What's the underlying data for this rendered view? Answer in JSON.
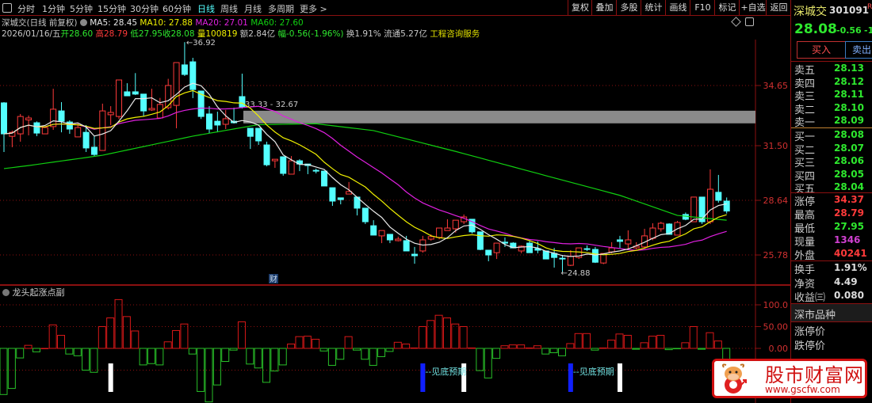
{
  "toolbar": {
    "tabs": [
      "分时",
      "1分钟",
      "5分钟",
      "15分钟",
      "30分钟",
      "60分钟",
      "日线",
      "周线",
      "月线",
      "多周期",
      "更多 >"
    ],
    "active_tab": "日线",
    "buttons": [
      "复权",
      "叠加",
      "多股",
      "统计",
      "画线",
      "F10",
      "标记",
      "+自选",
      "返回"
    ]
  },
  "info": {
    "title": "深城交(日线 前复权)",
    "ma5": "MA5: 28.45",
    "ma10": "MA10: 27.88",
    "ma20": "MA20: 27.01",
    "ma60": "MA60: 27.60",
    "date": "2026/01/16/五",
    "open_label": "开",
    "open": "28.60",
    "high_label": "高",
    "high": "28.79",
    "low_label": "低",
    "low": "27.95",
    "close_label": "收",
    "close": "28.08",
    "vol_label": "量",
    "vol": "100819",
    "amount": "额2.84亿",
    "change_label": "幅",
    "change": "-0.56(-1.96%)",
    "turnover": "换1.91%",
    "float": "流通5.27亿",
    "sector": "工程咨询服务"
  },
  "colors": {
    "up": "#ff3a3a",
    "down": "#54ffff",
    "ma5": "#e8e8e8",
    "ma10": "#f0f000",
    "ma20": "#e020e0",
    "ma60": "#10d010",
    "grid": "#8b1010",
    "axis_text": "#d03030",
    "band": "#8a8a8a"
  },
  "chart_data": [
    {
      "type": "candlestick",
      "price_ticks": [
        "34.65",
        "31.50",
        "28.64",
        "25.78"
      ],
      "ylim": [
        24.5,
        37.0
      ],
      "annotations": {
        "high_label": "36.92",
        "low_label": "24.88",
        "band_label": "33.33 - 32.67",
        "band": [
          32.67,
          33.33
        ],
        "finance_marker": "财"
      },
      "ohlc": [
        [
          33.74,
          33.78,
          31.17,
          32.12
        ],
        [
          31.99,
          32.29,
          31.42,
          32.2
        ],
        [
          32.12,
          33.16,
          31.71,
          33.03
        ],
        [
          32.85,
          33.08,
          32.04,
          32.95
        ],
        [
          32.7,
          32.77,
          32.0,
          32.16
        ],
        [
          32.12,
          32.45,
          32.12,
          32.45
        ],
        [
          32.5,
          34.48,
          32.33,
          33.41
        ],
        [
          33.32,
          33.78,
          32.2,
          32.78
        ],
        [
          32.74,
          32.83,
          32.12,
          32.37
        ],
        [
          31.96,
          32.7,
          31.96,
          32.45
        ],
        [
          32.2,
          32.58,
          31.17,
          31.38
        ],
        [
          31.42,
          32.0,
          30.96,
          31.04
        ],
        [
          31.25,
          33.7,
          31.25,
          33.32
        ],
        [
          33.12,
          33.57,
          32.58,
          33.24
        ],
        [
          33.03,
          34.94,
          32.9,
          34.94
        ],
        [
          34.32,
          34.77,
          34.11,
          34.11
        ],
        [
          34.32,
          35.3,
          34.15,
          34.2
        ],
        [
          34.2,
          34.2,
          33.03,
          33.32
        ],
        [
          33.37,
          34.48,
          33.32,
          33.45
        ],
        [
          32.95,
          34.0,
          32.95,
          33.66
        ],
        [
          33.49,
          35.0,
          33.4,
          34.65
        ],
        [
          33.61,
          35.85,
          32.41,
          35.85
        ],
        [
          35.73,
          36.92,
          35.15,
          35.23
        ],
        [
          35.89,
          36.1,
          33.99,
          34.44
        ],
        [
          34.36,
          34.36,
          32.9,
          33.03
        ],
        [
          33.16,
          33.57,
          32.16,
          32.37
        ],
        [
          32.78,
          33.28,
          32.2,
          32.58
        ],
        [
          32.62,
          33.37,
          32.37,
          32.91
        ],
        [
          32.78,
          33.49,
          32.66,
          32.7
        ],
        [
          34.07,
          35.27,
          33.45,
          33.53
        ],
        [
          32.41,
          32.41,
          31.33,
          31.99
        ],
        [
          32.41,
          32.41,
          31.54,
          31.75
        ],
        [
          31.54,
          31.71,
          30.42,
          30.5
        ],
        [
          30.71,
          30.79,
          30.34,
          30.79
        ],
        [
          30.92,
          30.92,
          29.93,
          30.05
        ],
        [
          30.01,
          30.96,
          30.01,
          30.71
        ],
        [
          30.71,
          30.79,
          30.17,
          30.54
        ],
        [
          30.54,
          30.54,
          30.01,
          30.46
        ],
        [
          30.21,
          30.3,
          30.05,
          30.17
        ],
        [
          30.17,
          30.17,
          29.39,
          29.39
        ],
        [
          29.3,
          29.3,
          28.35,
          28.6
        ],
        [
          28.77,
          28.77,
          28.43,
          28.68
        ],
        [
          28.97,
          29.6,
          28.97,
          29.1
        ],
        [
          28.81,
          28.81,
          27.85,
          28.23
        ],
        [
          28.23,
          28.23,
          27.4,
          27.52
        ],
        [
          27.31,
          27.6,
          26.82,
          26.82
        ],
        [
          26.78,
          27.06,
          26.4,
          27.06
        ],
        [
          26.86,
          26.86,
          26.4,
          26.57
        ],
        [
          26.53,
          26.74,
          26.49,
          26.61
        ],
        [
          26.53,
          26.78,
          25.99,
          25.99
        ],
        [
          25.82,
          26.2,
          25.32,
          25.74
        ],
        [
          25.99,
          26.78,
          25.9,
          26.57
        ],
        [
          26.61,
          26.86,
          26.53,
          26.74
        ],
        [
          26.7,
          27.19,
          26.6,
          27.19
        ],
        [
          27.06,
          27.65,
          27.06,
          27.19
        ],
        [
          27.15,
          27.6,
          26.95,
          27.6
        ],
        [
          27.52,
          27.9,
          27.4,
          27.77
        ],
        [
          27.65,
          27.65,
          26.9,
          26.99
        ],
        [
          26.99,
          26.99,
          26.03,
          26.07
        ],
        [
          26.03,
          26.03,
          25.45,
          25.78
        ],
        [
          25.9,
          26.4,
          25.57,
          26.4
        ],
        [
          26.45,
          26.7,
          26.2,
          26.4
        ],
        [
          26.4,
          26.45,
          26.15,
          26.15
        ],
        [
          25.99,
          26.28,
          25.87,
          26.24
        ],
        [
          26.4,
          26.53,
          25.9,
          25.9
        ],
        [
          26.11,
          26.49,
          25.87,
          26.03
        ],
        [
          25.99,
          25.99,
          25.57,
          25.57
        ],
        [
          25.86,
          26.15,
          25.12,
          25.65
        ],
        [
          25.61,
          25.78,
          24.88,
          25.57
        ],
        [
          25.24,
          26.03,
          25.2,
          25.7
        ],
        [
          25.65,
          26.15,
          25.57,
          26.15
        ],
        [
          26.11,
          26.28,
          25.99,
          26.07
        ],
        [
          26.07,
          26.2,
          25.36,
          25.4
        ],
        [
          25.36,
          25.86,
          25.3,
          25.86
        ],
        [
          25.94,
          26.45,
          25.86,
          26.15
        ],
        [
          26.57,
          26.78,
          26.15,
          26.49
        ],
        [
          26.36,
          27.07,
          26.07,
          26.57
        ],
        [
          26.15,
          26.45,
          26.07,
          26.24
        ],
        [
          26.2,
          27.15,
          26.1,
          26.78
        ],
        [
          26.65,
          27.44,
          26.55,
          27.19
        ],
        [
          27.15,
          27.52,
          27.0,
          27.44
        ],
        [
          27.4,
          27.44,
          26.86,
          26.86
        ],
        [
          26.82,
          27.56,
          26.82,
          27.48
        ],
        [
          27.9,
          28.0,
          27.6,
          27.65
        ],
        [
          27.52,
          28.81,
          27.52,
          28.81
        ],
        [
          28.81,
          28.81,
          27.4,
          27.52
        ],
        [
          27.52,
          30.26,
          27.4,
          29.22
        ],
        [
          29.06,
          29.97,
          28.52,
          28.64
        ],
        [
          28.6,
          28.79,
          27.95,
          28.08
        ]
      ],
      "ma60_keypoints": [
        [
          0,
          30.3
        ],
        [
          3,
          30.46
        ],
        [
          12,
          31.0
        ],
        [
          23,
          32.0
        ],
        [
          31,
          32.6
        ],
        [
          38,
          32.65
        ],
        [
          45,
          32.29
        ],
        [
          55,
          31.2
        ],
        [
          66,
          29.93
        ],
        [
          75,
          28.9
        ],
        [
          82,
          27.85
        ],
        [
          88,
          27.6
        ]
      ]
    },
    {
      "type": "bar",
      "title": "龙头起涨点副",
      "y_ticks": [
        "100.0",
        "50.00",
        "0.00"
      ],
      "ylim": [
        -125,
        115
      ],
      "values": [
        -106,
        -92,
        -22,
        7,
        -8,
        0,
        54,
        30,
        -13,
        -17,
        -50,
        -55,
        50,
        70,
        112,
        73,
        40,
        -38,
        -35,
        -38,
        15,
        41,
        56,
        -13,
        -99,
        -123,
        -84,
        -30,
        -4,
        61,
        -36,
        -45,
        -78,
        -52,
        -38,
        10,
        27,
        28,
        21,
        -6,
        -39,
        -25,
        27,
        -4,
        -25,
        -39,
        -19,
        -7,
        14,
        10,
        1,
        50,
        64,
        76,
        70,
        56,
        50,
        1,
        -51,
        -68,
        -23,
        6,
        8,
        8,
        1,
        6,
        -13,
        -10,
        -17,
        11,
        34,
        34,
        -4,
        1,
        19,
        33,
        30,
        -2,
        13,
        28,
        30,
        -3,
        -1,
        13,
        50,
        -2,
        36,
        17,
        -40
      ],
      "signals_white": [
        13,
        56,
        75
      ],
      "signals_blue": [
        51,
        69
      ],
      "signal_text": "见底预期"
    }
  ],
  "quote": {
    "name": "深城交",
    "code": "301091",
    "flag": "R",
    "price": "28.08",
    "change": "-0.56",
    "pct": "-1",
    "buy": "买入",
    "sell": "卖出",
    "asks": [
      {
        "l": "卖五",
        "v": "28.13"
      },
      {
        "l": "卖四",
        "v": "28.12"
      },
      {
        "l": "卖三",
        "v": "28.11"
      },
      {
        "l": "卖二",
        "v": "28.10"
      },
      {
        "l": "卖一",
        "v": "28.09"
      }
    ],
    "bids": [
      {
        "l": "买一",
        "v": "28.08"
      },
      {
        "l": "买二",
        "v": "28.07"
      },
      {
        "l": "买三",
        "v": "28.06"
      },
      {
        "l": "买四",
        "v": "28.05"
      },
      {
        "l": "买五",
        "v": "28.04"
      }
    ],
    "stats": [
      {
        "l": "涨停",
        "v": "34.37"
      },
      {
        "l": "最高",
        "v": "28.79"
      },
      {
        "l": "最低",
        "v": "27.95"
      },
      {
        "l": "现量",
        "v": "1346"
      },
      {
        "l": "外盘",
        "v": "40241"
      }
    ],
    "stats2": [
      {
        "l": "换手",
        "v": "1.91%"
      },
      {
        "l": "净资",
        "v": "4.49"
      },
      {
        "l": "收益㈢",
        "v": "0.080"
      }
    ],
    "market": "深市品种",
    "limit_up": "涨停价",
    "limit_down": "跌停价"
  },
  "watermark": {
    "name": "股市财富网",
    "url": "www.gscfw.com"
  }
}
